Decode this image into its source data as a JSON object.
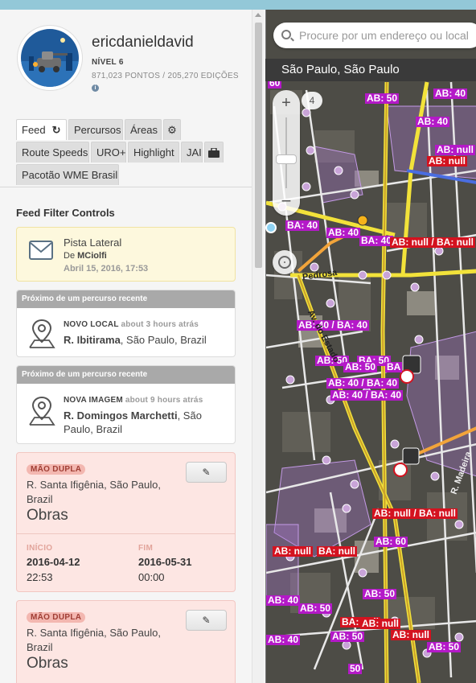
{
  "profile": {
    "username": "ericdanieldavid",
    "level": "NÍVEL 6",
    "points": "871,023 PONTOS",
    "edits": "205,270 EDIÇÕES",
    "separator": "/"
  },
  "tabs": [
    {
      "label": "Feed",
      "active": true
    },
    {
      "label": "Percursos"
    },
    {
      "label": "Áreas"
    },
    {
      "label": "Route Speeds"
    },
    {
      "label": "URO+"
    },
    {
      "label": "Highlight"
    },
    {
      "label": "JAI"
    },
    {
      "label": "Pacotão WME Brasil"
    }
  ],
  "feed": {
    "title": "Feed Filter Controls",
    "message": {
      "title": "Pista Lateral",
      "from_prefix": "De",
      "from_user": "MCiolfi",
      "date": "Abril 15, 2016, 17:53"
    },
    "nearby": [
      {
        "header": "Próximo de um percurso recente",
        "type": "NOVO LOCAL",
        "ago": "about 3 hours atrás",
        "street": "R. Ibitirama",
        "city": ", São Paulo, Brazil"
      },
      {
        "header": "Próximo de um percurso recente",
        "type": "NOVA IMAGEM",
        "ago": "about 9 hours atrás",
        "street": "R. Domingos Marchetti",
        "city": ", São Paulo, Brazil"
      }
    ],
    "closures": [
      {
        "badge": "MÃO DUPLA",
        "street": "R. Santa Ifigênia, São Paulo, Brazil",
        "reason": "Obras",
        "start_label": "INÍCIO",
        "start_date": "2016-04-12",
        "start_time": "22:53",
        "end_label": "FIM",
        "end_date": "2016-05-31",
        "end_time": "00:00"
      },
      {
        "badge": "MÃO DUPLA",
        "street": "R. Santa Ifigênia, São Paulo, Brazil",
        "reason": "Obras"
      }
    ]
  },
  "map": {
    "search_placeholder": "Procure por um endereço ou local",
    "location": "São Paulo, São Paulo",
    "zoom_level": "4",
    "zoom_plus": "+",
    "zoom_minus": "−",
    "labels": [
      "60",
      "AB: 50",
      "AB: 40",
      "AB: 40",
      "AB: null",
      "AB: null",
      "BA: 40",
      "AB: 40",
      "BA: 40",
      "AB: null / BA: null",
      "AB: 40 / BA: 40",
      "AB: 50",
      "BA: 50",
      "AB: 50",
      "BA",
      "AB: 40 / BA: 40",
      "AB: 40 / BA: 40",
      "AB: null / BA: null",
      "AB: null",
      "BA: null",
      "AB: 60",
      "AB: 50",
      "AB: 40",
      "AB: 50",
      "BA: null",
      "AB: null",
      "AB: null",
      "AB: 50",
      "AB: 40",
      "AB: 50",
      "50"
    ],
    "streets": [
      "Pedrosa",
      "R. Madeira",
      "Av. do Estado"
    ],
    "colors": {
      "ab_label": "#b419c8",
      "ba_label": "#d4121f",
      "road": "#f2e23a"
    }
  }
}
